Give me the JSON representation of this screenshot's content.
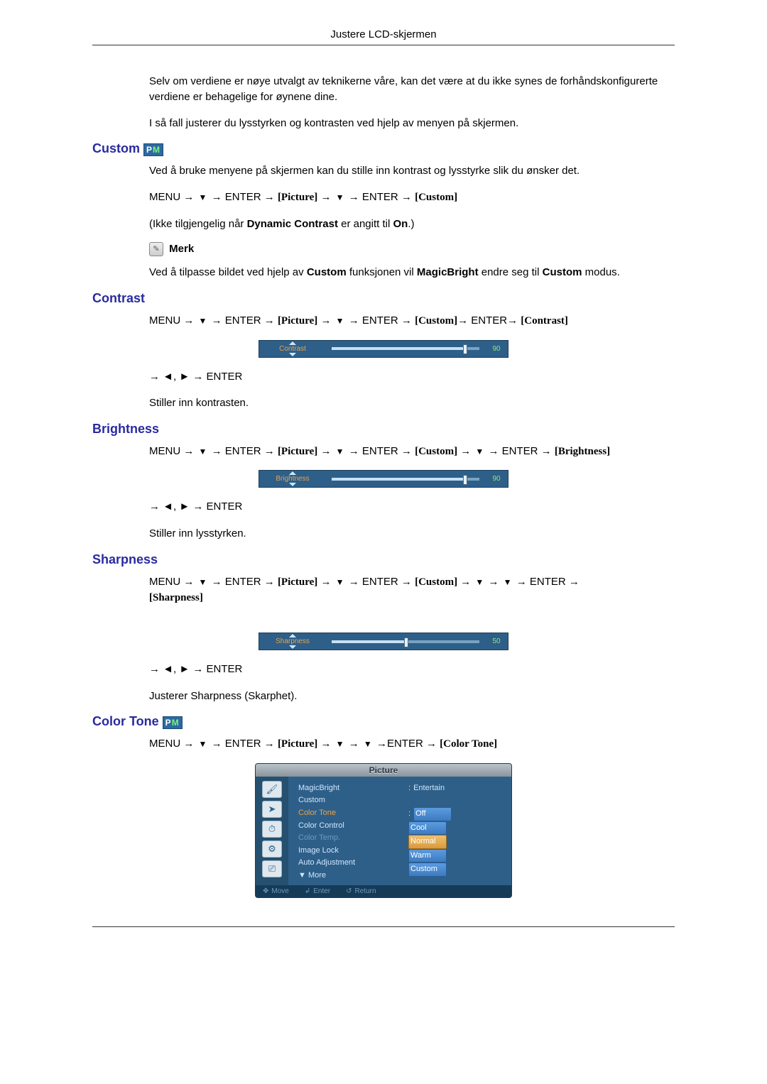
{
  "header": {
    "title": "Justere LCD-skjermen"
  },
  "intro": {
    "p1": "Selv om verdiene er nøye utvalgt av teknikerne våre, kan det være at du ikke synes de forhåndskonfigurerte verdiene er behagelige for øynene dine.",
    "p2": "I så fall justerer du lysstyrken og kontrasten ved hjelp av menyen på skjermen."
  },
  "custom": {
    "heading": "Custom",
    "pm_badge": "PM",
    "desc": "Ved å bruke menyene på skjermen kan du stille inn kontrast og lysstyrke slik du ønsker det.",
    "seq": {
      "menu": "MENU",
      "enter": "ENTER",
      "picture": "[Picture]",
      "custom": "[Custom]"
    },
    "not_available_pre": "(Ikke tilgjengelig når ",
    "dyn_contrast": "Dynamic Contrast",
    "not_available_mid": " er angitt til ",
    "on": "On",
    "not_available_post": ".)",
    "note_label": "Merk",
    "note_text_pre": "Ved å tilpasse bildet ved hjelp av ",
    "note_custom": "Custom",
    "note_text_mid1": " funksjonen vil ",
    "note_magicbright": "MagicBright",
    "note_text_mid2": " endre seg til ",
    "note_custom2": "Custom",
    "note_text_post": " modus."
  },
  "contrast": {
    "heading": "Contrast",
    "seq": {
      "menu": "MENU",
      "enter": "ENTER",
      "picture": "[Picture]",
      "custom": "[Custom]",
      "contrast": "[Contrast]"
    },
    "slider": {
      "label": "Contrast",
      "value": "90",
      "percent": 90
    },
    "nav": "→ ◄, ► → ENTER",
    "desc": "Stiller inn kontrasten."
  },
  "brightness": {
    "heading": "Brightness",
    "seq": {
      "menu": "MENU",
      "enter": "ENTER",
      "picture": "[Picture]",
      "custom": "[Custom]",
      "brightness": "[Brightness]"
    },
    "slider": {
      "label": "Brightness",
      "value": "90",
      "percent": 90
    },
    "nav": "→ ◄, ► → ENTER",
    "desc": "Stiller inn lysstyrken."
  },
  "sharpness": {
    "heading": "Sharpness",
    "seq": {
      "menu": "MENU",
      "enter": "ENTER",
      "picture": "[Picture]",
      "custom": "[Custom]",
      "sharpness": "[Sharpness]"
    },
    "slider": {
      "label": "Sharpness",
      "value": "50",
      "percent": 50
    },
    "nav": "→ ◄, ► → ENTER",
    "desc": "Justerer Sharpness (Skarphet)."
  },
  "color_tone": {
    "heading": "Color Tone",
    "pm_badge": "PM",
    "seq": {
      "menu": "MENU",
      "enter": "ENTER",
      "picture": "[Picture]",
      "color_tone": "[Color Tone]"
    },
    "osd": {
      "title": "Picture",
      "left_items": [
        "MagicBright",
        "Custom",
        "Color Tone",
        "Color Control",
        "Color Temp.",
        "Image Lock",
        "Auto Adjustment",
        "▼ More"
      ],
      "right_label": "Entertain",
      "right_options": [
        "Off",
        "Cool",
        "Normal",
        "Warm",
        "Custom"
      ],
      "right_selected_index": 2,
      "footer": {
        "move": "Move",
        "enter": "Enter",
        "return": "Return"
      }
    }
  }
}
